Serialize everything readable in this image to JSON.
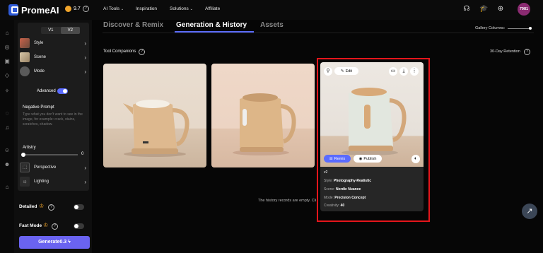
{
  "header": {
    "logo": "PromeAI",
    "credits": "9.7",
    "nav": [
      "AI Tools",
      "Inspiration",
      "Solutions",
      "Affiliate"
    ],
    "avatar_text": "7981"
  },
  "rail": {
    "icons": [
      "home-icon",
      "explore-icon",
      "image-icon",
      "cube-icon",
      "bulb-icon",
      "compass-icon",
      "bell-icon",
      "user-icon",
      "users-icon",
      "shop-icon"
    ]
  },
  "panel": {
    "versions": [
      "V1",
      "V2"
    ],
    "selected_version": "V2",
    "style_label": "Style",
    "scene_label": "Scene",
    "mode_label": "Mode",
    "advanced_label": "Advanced",
    "negative_prompt_label": "Negative Prompt",
    "negative_prompt_placeholder": "Type what you don't want to see in the image, for example: crack, stains, scratches, shadow.",
    "artistry_label": "Artistry",
    "artistry_value": "0",
    "perspective_label": "Perspective",
    "lighting_label": "Lighting",
    "detailed_label": "Detailed",
    "fast_mode_label": "Fast Mode",
    "generate_label": "Generate0.3"
  },
  "main": {
    "tabs": [
      "Discover & Remix",
      "Generation & History",
      "Assets"
    ],
    "active_tab": "Generation & History",
    "gallery_columns_label": "Gallery Columns:",
    "tool_companions_label": "Tool Companions",
    "retention_label": "30-Day Retention",
    "empty_text": "The history records are empty. Cli",
    "card": {
      "edit_label": "Edit",
      "remix_label": "Remix",
      "publish_label": "Publish",
      "version": "v2",
      "style_key": "Style:",
      "style_value": "Photography-Realistic",
      "scene_key": "Scene:",
      "scene_value": "Nordic Nuance",
      "mode_key": "Mode:",
      "mode_value": "Precision Concept",
      "creativity_key": "Creativity:",
      "creativity_value": "40"
    }
  },
  "colors": {
    "accent": "#5a6bff",
    "generate": "#6a63f0",
    "highlight": "#e4151b",
    "avatar": "#8b2b72"
  }
}
